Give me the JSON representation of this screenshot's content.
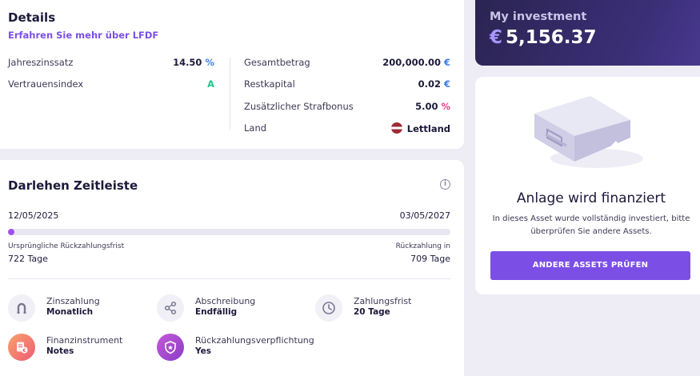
{
  "details": {
    "title": "Details",
    "link": "Erfahren Sie mehr über LFDF",
    "left_rows": [
      {
        "label": "Jahreszinssatz",
        "value": "14.50",
        "unit": "%"
      },
      {
        "label": "Vertrauensindex",
        "value": "",
        "unit": "A"
      }
    ],
    "right_rows": [
      {
        "label": "Gesamtbetrag",
        "value": "200,000.00",
        "unit": "€"
      },
      {
        "label": "Restkapital",
        "value": "0.02",
        "unit": "€"
      },
      {
        "label": "Zusätzlicher Strafbonus",
        "value": "5.00",
        "unit": "%"
      },
      {
        "label": "Land",
        "value": "Lettland",
        "unit": ""
      }
    ],
    "colors": {
      "blue": "#3b7fe6",
      "green": "#1fc48e",
      "pink": "#e8418a"
    }
  },
  "timeline": {
    "title": "Darlehen Zeitleiste",
    "start_date": "12/05/2025",
    "end_date": "03/05/2027",
    "progress_percent": 1.5,
    "left_caption": "Ursprüngliche Rückzahlungsfrist",
    "left_value": "722 Tage",
    "right_caption": "Rückzahlung in",
    "right_value": "709 Tage",
    "features": [
      {
        "title": "Zinszahlung",
        "value": "Monatlich",
        "icon": "horseshoe-icon"
      },
      {
        "title": "Abschreibung",
        "value": "Endfällig",
        "icon": "share-nodes-icon"
      },
      {
        "title": "Zahlungsfrist",
        "value": "20 Tage",
        "icon": "clock-icon"
      },
      {
        "title": "Finanzinstrument",
        "value": "Notes",
        "icon": "document-euro-icon"
      },
      {
        "title": "Rückzahlungsverpflichtung",
        "value": "Yes",
        "icon": "shield-icon"
      }
    ]
  },
  "investment": {
    "title": "My investment",
    "currency": "€",
    "amount": "5,156.37"
  },
  "status": {
    "title": "Anlage wird finanziert",
    "description": "In dieses Asset wurde vollständig investiert, bitte überprüfen Sie andere Assets.",
    "button": "ANDERE ASSETS PRÜFEN",
    "accent": "#7b4fe6"
  }
}
